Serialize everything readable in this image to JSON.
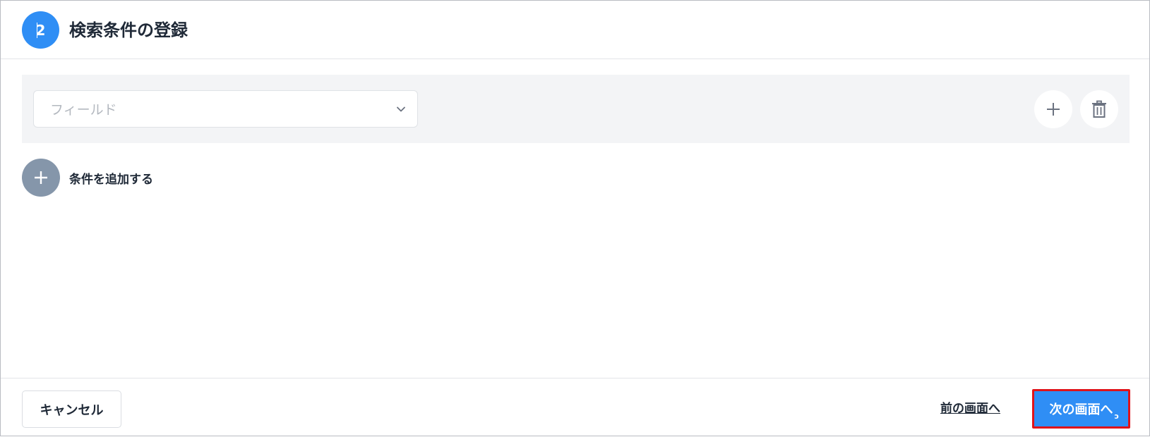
{
  "header": {
    "step_number": "2",
    "title": "検索条件の登録"
  },
  "condition": {
    "field_placeholder": "フィールド",
    "field_value": "",
    "icons": {
      "chevron": "chevron-down-icon",
      "add": "plus-icon",
      "delete": "trash-icon"
    }
  },
  "add_condition": {
    "label": "条件を追加する",
    "icon": "plus-icon"
  },
  "footer": {
    "cancel_label": "キャンセル",
    "prev_label": "前の画面へ",
    "next_label": "次の画面へ"
  },
  "colors": {
    "primary": "#2f8ef5",
    "highlight_border": "#e0131a",
    "row_background": "#f3f4f6",
    "add_circle": "#8596aa"
  }
}
